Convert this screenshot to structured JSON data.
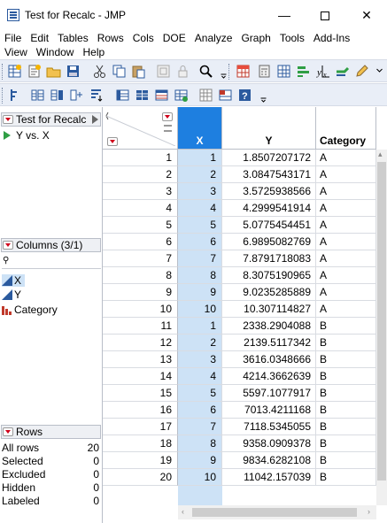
{
  "window": {
    "title": "Test for Recalc - JMP",
    "minimize": "—",
    "close": "✕"
  },
  "menu": {
    "row1": [
      "File",
      "Edit",
      "Tables",
      "Rows",
      "Cols",
      "DOE",
      "Analyze",
      "Graph",
      "Tools",
      "Add-Ins"
    ],
    "row2": [
      "View",
      "Window",
      "Help"
    ]
  },
  "table_panel": {
    "title": "Test for Recalc",
    "scripts": [
      "Y vs. X"
    ]
  },
  "columns_panel": {
    "title": "Columns (3/1)",
    "search_placeholder": "",
    "search_icon": "⚲",
    "columns": [
      {
        "name": "X",
        "type": "continuous",
        "selected": true
      },
      {
        "name": "Y",
        "type": "continuous",
        "selected": false
      },
      {
        "name": "Category",
        "type": "nominal",
        "selected": false
      }
    ]
  },
  "rows_panel": {
    "title": "Rows",
    "stats": [
      {
        "label": "All rows",
        "value": "20"
      },
      {
        "label": "Selected",
        "value": "0"
      },
      {
        "label": "Excluded",
        "value": "0"
      },
      {
        "label": "Hidden",
        "value": "0"
      },
      {
        "label": "Labeled",
        "value": "0"
      }
    ]
  },
  "grid": {
    "headers": {
      "x": "X",
      "y": "Y",
      "category": "Category"
    },
    "rows": [
      {
        "n": "1",
        "x": "1",
        "y": "1.8507207172",
        "cat": "A"
      },
      {
        "n": "2",
        "x": "2",
        "y": "3.0847543171",
        "cat": "A"
      },
      {
        "n": "3",
        "x": "3",
        "y": "3.5725938566",
        "cat": "A"
      },
      {
        "n": "4",
        "x": "4",
        "y": "4.2999541914",
        "cat": "A"
      },
      {
        "n": "5",
        "x": "5",
        "y": "5.0775454451",
        "cat": "A"
      },
      {
        "n": "6",
        "x": "6",
        "y": "6.9895082769",
        "cat": "A"
      },
      {
        "n": "7",
        "x": "7",
        "y": "7.8791718083",
        "cat": "A"
      },
      {
        "n": "8",
        "x": "8",
        "y": "8.3075190965",
        "cat": "A"
      },
      {
        "n": "9",
        "x": "9",
        "y": "9.0235285889",
        "cat": "A"
      },
      {
        "n": "10",
        "x": "10",
        "y": "10.307114827",
        "cat": "A"
      },
      {
        "n": "11",
        "x": "1",
        "y": "2338.2904088",
        "cat": "B"
      },
      {
        "n": "12",
        "x": "2",
        "y": "2139.5117342",
        "cat": "B"
      },
      {
        "n": "13",
        "x": "3",
        "y": "3616.0348666",
        "cat": "B"
      },
      {
        "n": "14",
        "x": "4",
        "y": "4214.3662639",
        "cat": "B"
      },
      {
        "n": "15",
        "x": "5",
        "y": "5597.1077917",
        "cat": "B"
      },
      {
        "n": "16",
        "x": "6",
        "y": "7013.4211168",
        "cat": "B"
      },
      {
        "n": "17",
        "x": "7",
        "y": "7118.5345055",
        "cat": "B"
      },
      {
        "n": "18",
        "x": "8",
        "y": "9358.0909378",
        "cat": "B"
      },
      {
        "n": "19",
        "x": "9",
        "y": "9834.6282108",
        "cat": "B"
      },
      {
        "n": "20",
        "x": "10",
        "y": "11042.157039",
        "cat": "B"
      }
    ]
  },
  "colors": {
    "selected_column": "#1e7fe0",
    "selected_column_cells": "#cde2f6",
    "red_triangle": "#d0021b",
    "toolbar_bg": "#e9eef7"
  }
}
